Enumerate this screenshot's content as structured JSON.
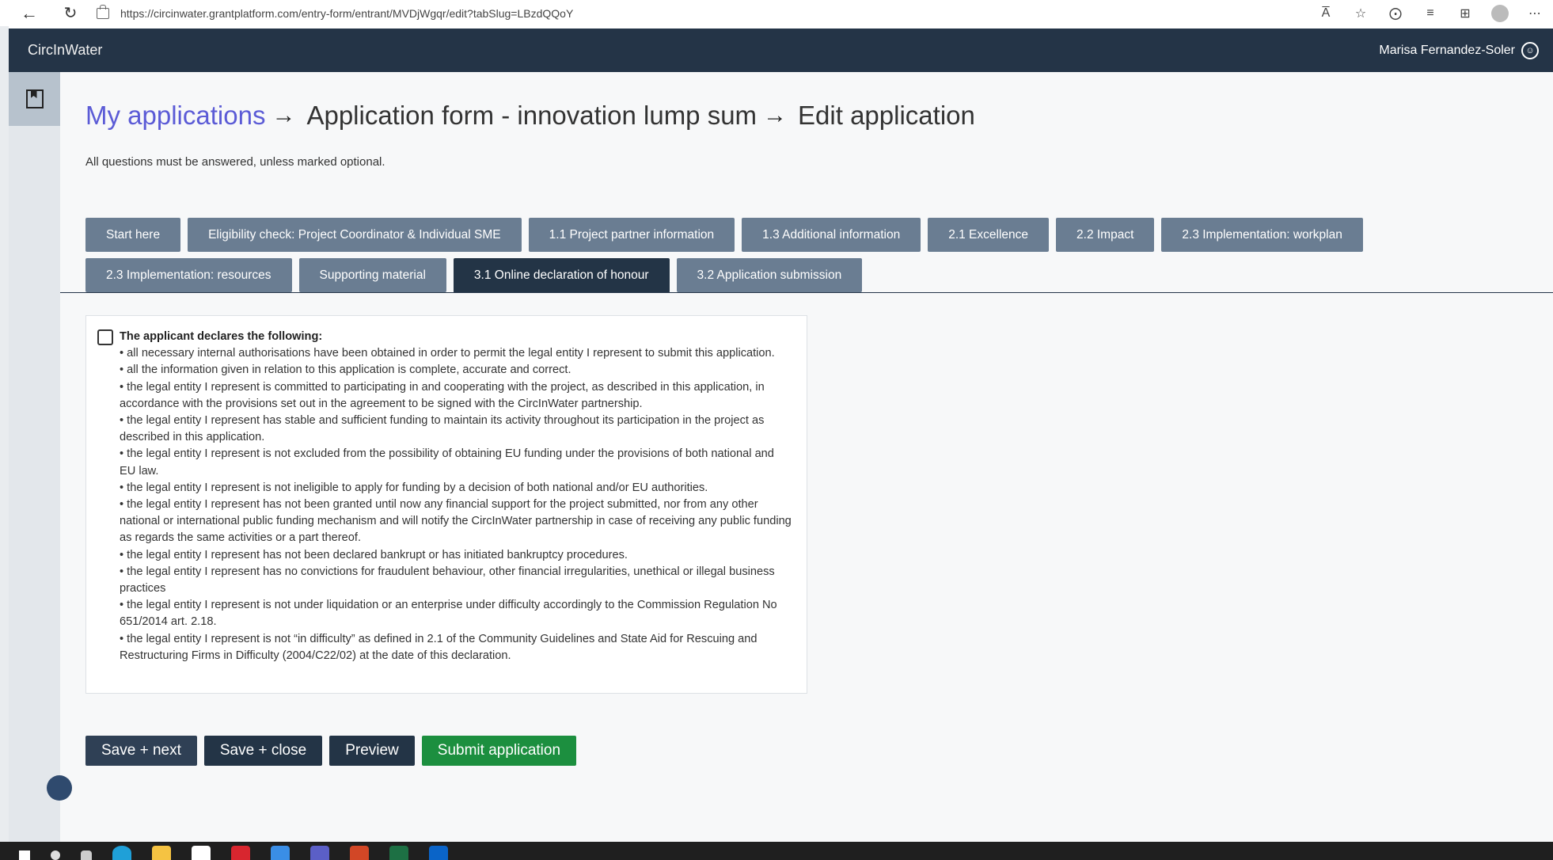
{
  "browser": {
    "url": "https://circinwater.grantplatform.com/entry-form/entrant/MVDjWgqr/edit?tabSlug=LBzdQQoY",
    "read_aloud_label": "A̅"
  },
  "header": {
    "brand": "CircInWater",
    "user_name": "Marisa Fernandez-Soler"
  },
  "breadcrumb": {
    "link": "My applications",
    "arrow": "→",
    "form": "Application form - innovation lump sum",
    "current": "Edit application"
  },
  "hint": "All questions must be answered, unless marked optional.",
  "tabs": [
    {
      "label": "Start here"
    },
    {
      "label": "Eligibility check: Project Coordinator & Individual SME"
    },
    {
      "label": "1.1 Project partner information"
    },
    {
      "label": "1.3 Additional information"
    },
    {
      "label": "2.1 Excellence"
    },
    {
      "label": "2.2 Impact"
    },
    {
      "label": "2.3 Implementation: workplan"
    },
    {
      "label": "2.3 Implementation: resources"
    },
    {
      "label": "Supporting material"
    },
    {
      "label": "3.1 Online declaration of honour"
    },
    {
      "label": "3.2 Application submission"
    }
  ],
  "active_tab": "3.1 Online declaration of honour",
  "declaration": {
    "checked": false,
    "title": "The applicant declares the following:",
    "items": [
      "• all necessary internal authorisations have been obtained in order to permit the legal entity I represent to submit this application.",
      "• all the information given in relation to this application is complete, accurate and correct.",
      "• the legal entity I represent is committed to participating in and cooperating with the project, as described in this application, in accordance with the provisions set out in the agreement to be signed with the CircInWater partnership.",
      "• the legal entity I represent has stable and sufficient funding to maintain its activity throughout its participation in the project as described in this application.",
      "• the legal entity I represent is not excluded from the possibility of obtaining EU funding under the provisions of both national and EU law.",
      "• the legal entity I represent is not ineligible to apply for funding by a decision of both national and/or EU authorities.",
      "• the legal entity I represent has not been granted until now any financial support for the project submitted, nor from any other national or international public funding mechanism and will notify the CircInWater partnership in case of receiving any public funding as regards the same activities or a part thereof.",
      "• the legal entity I represent has not been declared bankrupt or has initiated bankruptcy procedures.",
      "• the legal entity I represent has no convictions for fraudulent behaviour, other financial irregularities, unethical or illegal business practices",
      "• the legal entity I represent is not under liquidation or an enterprise under difficulty accordingly to the Commission Regulation No 651/2014 art. 2.18.",
      "• the legal entity I represent is not “in difficulty” as defined in 2.1 of the Community Guidelines and State Aid for Rescuing and Restructuring Firms in Difficulty (2004/C22/02) at the date of this declaration."
    ]
  },
  "actions": {
    "save_next": "Save + next",
    "save_close": "Save + close",
    "preview": "Preview",
    "submit": "Submit application"
  },
  "colors": {
    "header_bg": "#243447",
    "tab_bg": "#6a7d92",
    "tab_active_bg": "#233446",
    "link": "#5b5bd6",
    "submit_green": "#1c8f3f"
  }
}
